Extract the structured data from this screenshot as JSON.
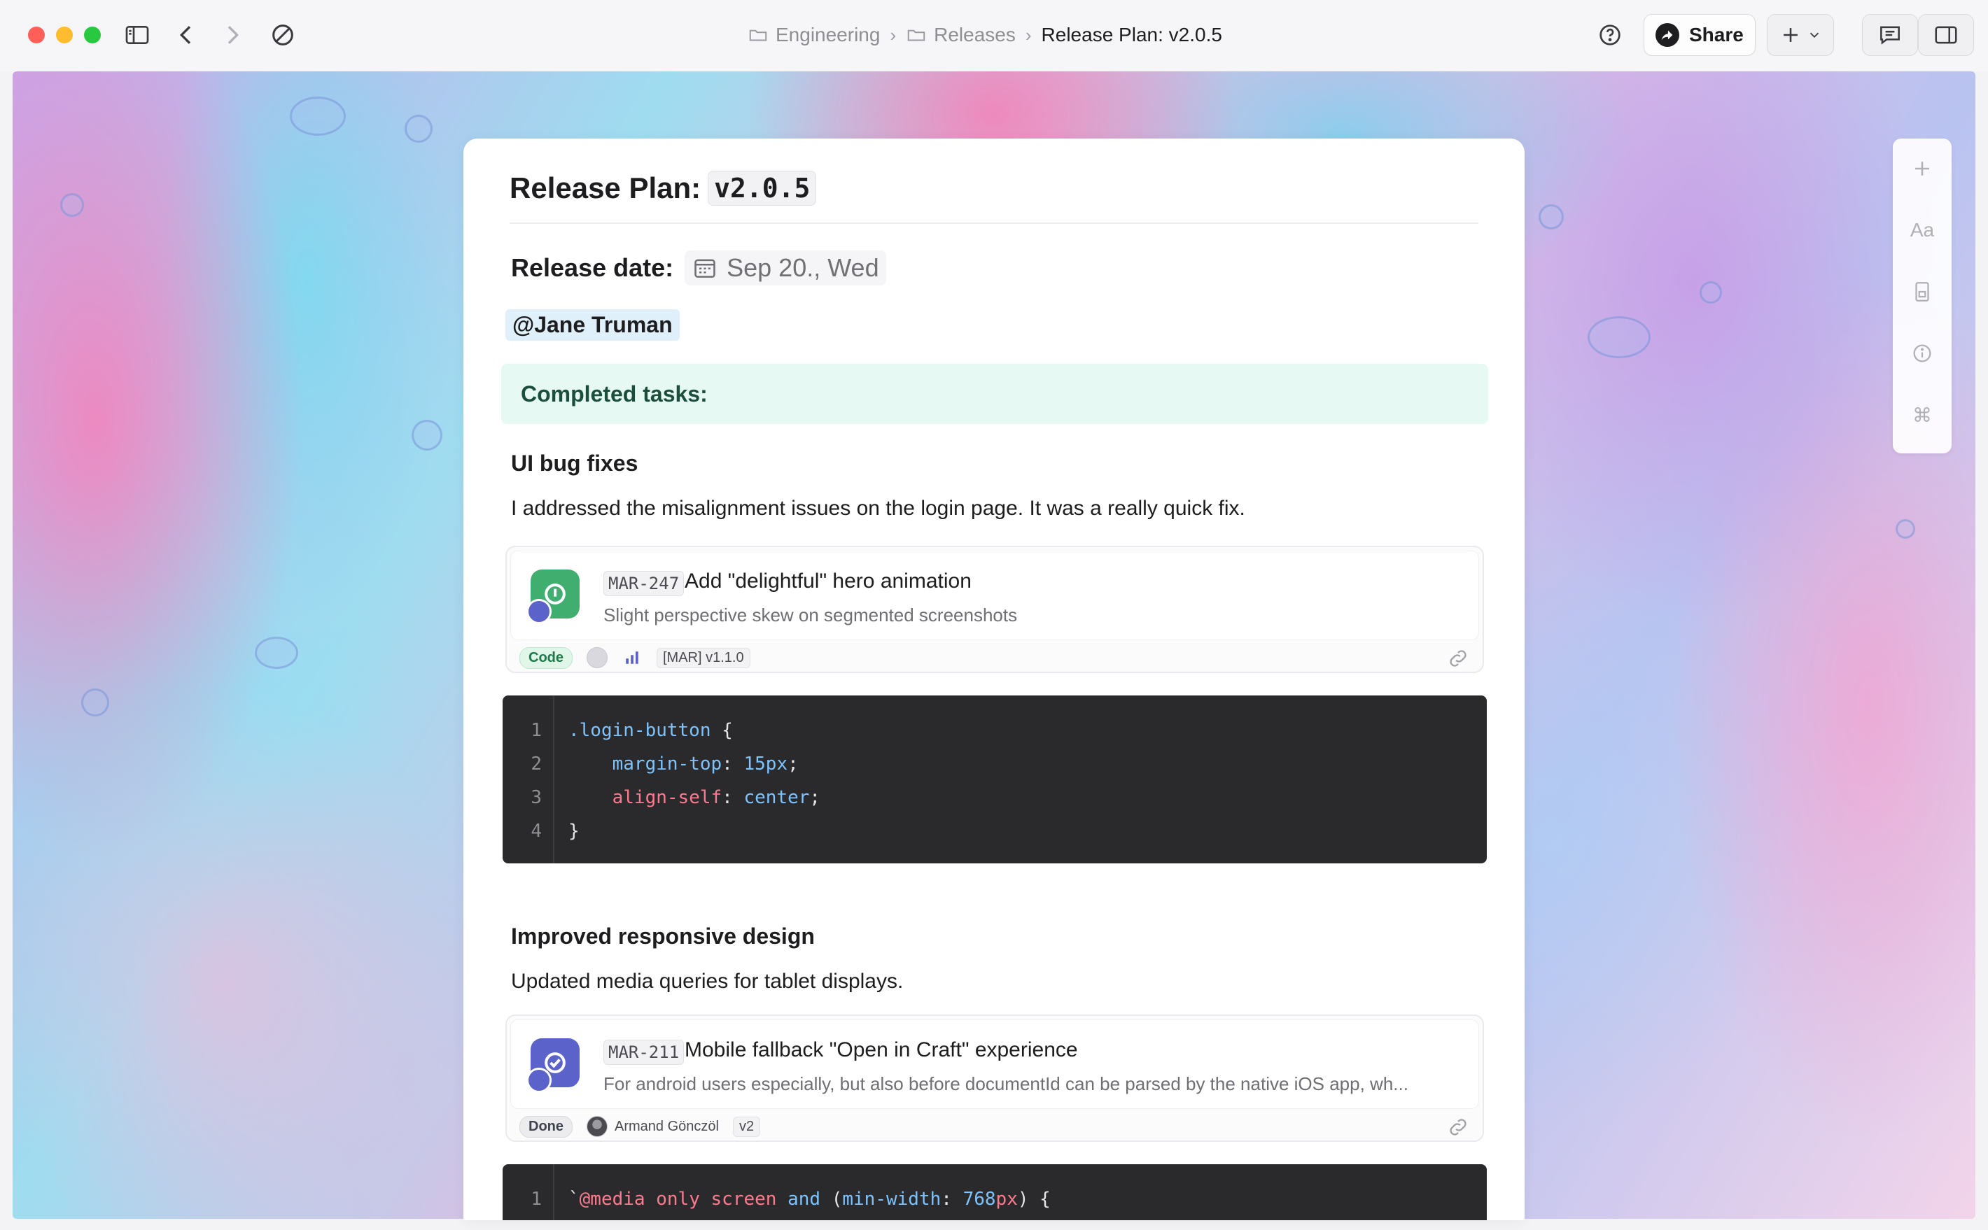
{
  "window": {
    "breadcrumb": [
      "Engineering",
      "Releases",
      "Release Plan: v2.0.5"
    ],
    "share_label": "Share"
  },
  "doc": {
    "title_prefix": "Release Plan:",
    "title_code": "v2.0.5",
    "release_label": "Release date:",
    "release_date": "Sep 20., Wed",
    "mention": "@Jane Truman",
    "callout": "Completed tasks:",
    "sections": [
      {
        "heading": "UI bug fixes",
        "text": "I addressed the misalignment issues on the login page. It was a really quick fix.",
        "task": {
          "key": "MAR-247",
          "title": "Add \"delightful\" hero animation",
          "description": "Slight perspective skew on segmented screenshots",
          "status": "Code",
          "tag": "[MAR] v1.1.0",
          "icon": "linear-issue-icon",
          "icon_color": "#3fae6f"
        },
        "code": [
          {
            "line": "1",
            "tokens": [
              [
                ".login-button",
                "sel"
              ],
              [
                " {",
                "plain"
              ]
            ]
          },
          {
            "line": "2",
            "tokens": [
              [
                "    ",
                "plain"
              ],
              [
                "margin-top",
                "prop"
              ],
              [
                ": ",
                "plain"
              ],
              [
                "15px",
                "val"
              ],
              [
                ";",
                "plain"
              ]
            ]
          },
          {
            "line": "3",
            "tokens": [
              [
                "    ",
                "plain"
              ],
              [
                "align-self",
                "prop2"
              ],
              [
                ": ",
                "plain"
              ],
              [
                "center",
                "val"
              ],
              [
                ";",
                "plain"
              ]
            ]
          },
          {
            "line": "4",
            "tokens": [
              [
                "}",
                "plain"
              ]
            ]
          }
        ]
      },
      {
        "heading": "Improved responsive design",
        "text": "Updated media queries for tablet displays.",
        "task": {
          "key": "MAR-211",
          "title": "Mobile fallback \"Open in Craft\" experience",
          "description": "For android users especially, but also before documentId can be parsed by the native iOS app, wh...",
          "status": "Done",
          "assignee": "Armand Gönczöl",
          "tag": "v2",
          "icon": "check-badge-icon",
          "icon_color": "#5b62c9"
        },
        "code": [
          {
            "line": "1",
            "tokens": [
              [
                "`",
                "plain"
              ],
              [
                "@media",
                "at"
              ],
              [
                " ",
                "plain"
              ],
              [
                "only",
                "kw"
              ],
              [
                " ",
                "plain"
              ],
              [
                "screen",
                "kw"
              ],
              [
                " ",
                "plain"
              ],
              [
                "and",
                "val"
              ],
              [
                " (",
                "plain"
              ],
              [
                "min-width",
                "prop"
              ],
              [
                ": ",
                "plain"
              ],
              [
                "768",
                "num"
              ],
              [
                "px",
                "kw"
              ],
              [
                ") {",
                "plain"
              ]
            ]
          }
        ]
      }
    ]
  },
  "colors": {
    "accent": "#5b62c9",
    "callout_bg": "#e6f9f3",
    "code_bg": "#2a2a2c"
  }
}
